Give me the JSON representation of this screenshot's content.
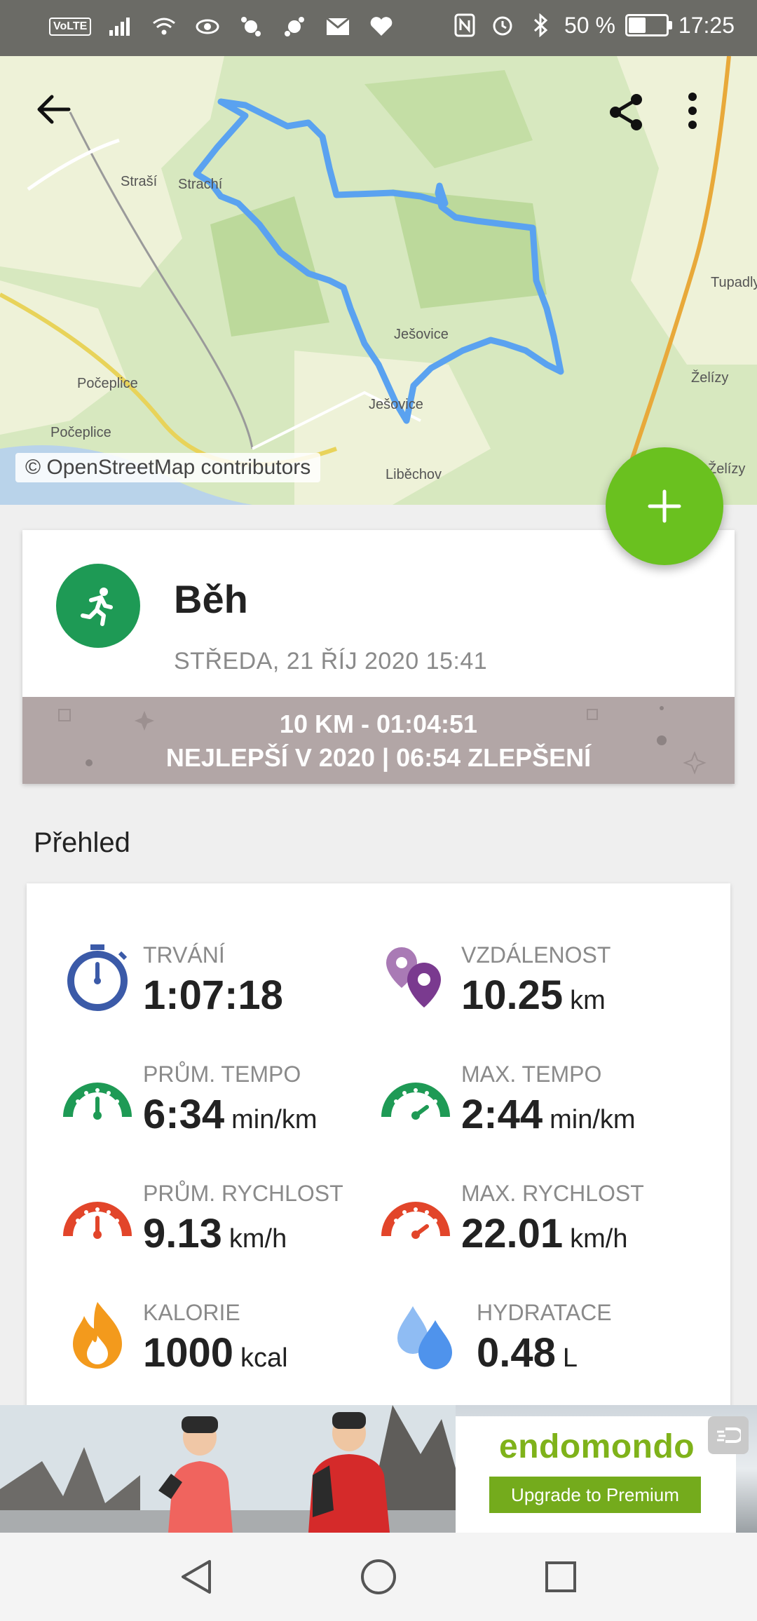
{
  "status_bar": {
    "left_icons": [
      "signal-icon",
      "wifi-icon",
      "eye-icon",
      "app-icon",
      "app-icon",
      "mail-icon",
      "heart-icon"
    ],
    "volte": "VoLTE",
    "battery_text": "50 %",
    "battery_level": 0.5,
    "time": "17:25"
  },
  "map": {
    "attribution": "© OpenStreetMap contributors",
    "places": [
      "Straší",
      "Strachí",
      "Ješovice",
      "Ješovice",
      "Počeplice",
      "Počeplice",
      "Liběchov",
      "Želízy",
      "Tupadly",
      "Želízy"
    ],
    "route_color": "#5aa2f0"
  },
  "activity": {
    "title": "Běh",
    "datetime": "STŘEDA, 21 ŘÍJ 2020 15:41",
    "record_line1": "10 KM  -  01:04:51",
    "record_line2": "NEJLEPŠÍ V 2020  |  06:54 ZLEPŠENÍ"
  },
  "overview": {
    "title": "Přehled",
    "stats": [
      {
        "label": "TRVÁNÍ",
        "value": "1:07:18",
        "unit": "",
        "icon": "stopwatch-icon",
        "color": "#3b5aa8"
      },
      {
        "label": "VZDÁLENOST",
        "value": "10.25",
        "unit": "km",
        "icon": "location-pins-icon",
        "color": "#7a3a8f"
      },
      {
        "label": "PRŮM. TEMPO",
        "value": "6:34",
        "unit": "min/km",
        "icon": "speedometer-icon",
        "color": "#1e9a55"
      },
      {
        "label": "MAX. TEMPO",
        "value": "2:44",
        "unit": "min/km",
        "icon": "speedometer-icon",
        "color": "#1e9a55"
      },
      {
        "label": "PRŮM. RYCHLOST",
        "value": "9.13",
        "unit": "km/h",
        "icon": "speedometer-icon",
        "color": "#e2452a"
      },
      {
        "label": "MAX. RYCHLOST",
        "value": "22.01",
        "unit": "km/h",
        "icon": "speedometer-icon",
        "color": "#e2452a"
      },
      {
        "label": "KALORIE",
        "value": "1000",
        "unit": "kcal",
        "icon": "flame-icon",
        "color": "#f39a1c"
      },
      {
        "label": "HYDRATACE",
        "value": "0.48",
        "unit": "L",
        "icon": "water-drops-icon",
        "color": "#5a9df0"
      }
    ]
  },
  "ad": {
    "brand": "endomondo",
    "button": "Upgrade to Premium"
  },
  "colors": {
    "accent": "#6ac11f",
    "sport": "#1e9a55"
  }
}
